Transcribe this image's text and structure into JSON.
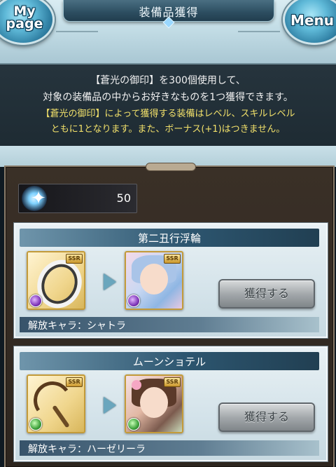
{
  "header": {
    "title": "装備品獲得",
    "mypage_label_1": "My",
    "mypage_label_2": "page",
    "menu_label": "Menu"
  },
  "description": {
    "line1": "【蒼光の御印】を300個使用して、",
    "line2": "対象の装備品の中からお好きなものを1つ獲得できます。",
    "note1": "【蒼光の御印】によって獲得する装備はレベル、スキルレベル",
    "note2": "ともに1となります。また、ボーナス(+1)はつきません。"
  },
  "currency": {
    "icon": "crystal-icon",
    "count": "50"
  },
  "items": [
    {
      "name": "第二丑行浮輪",
      "rarity": "SSR",
      "weapon_element": "dark",
      "chara_element": "dark",
      "button": "獲得する",
      "unlock": "解放キャラ：シャトラ"
    },
    {
      "name": "ムーンショテル",
      "rarity": "SSR",
      "weapon_element": "wind",
      "chara_element": "wind",
      "button": "獲得する",
      "unlock": "解放キャラ：ハーゼリーラ"
    }
  ],
  "colors": {
    "note_yellow": "#f1e06a",
    "header_plate": "#2c4d60",
    "panel_bg": "#2d251e"
  }
}
